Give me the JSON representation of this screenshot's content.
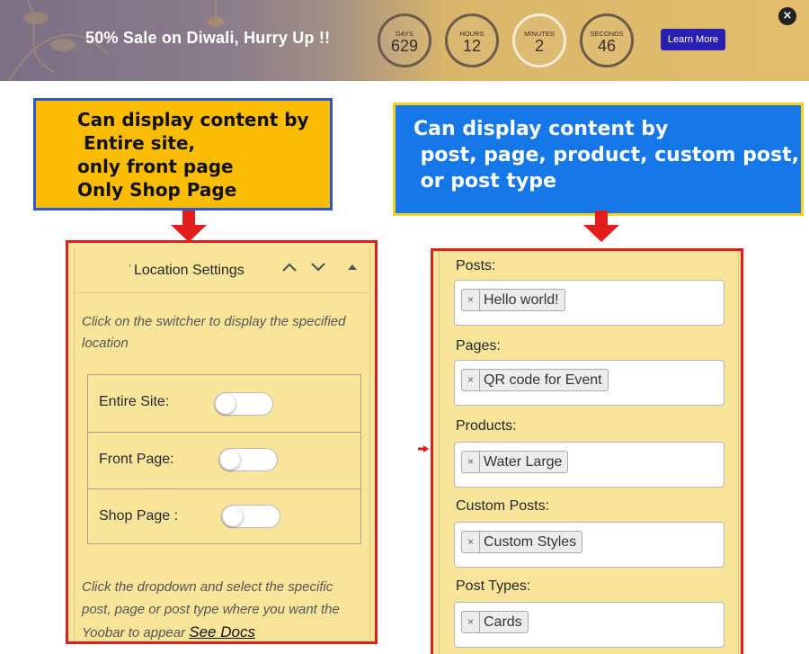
{
  "promo": {
    "text": "50% Sale on Diwali, Hurry Up !!",
    "timers": [
      {
        "unit": "DAYS",
        "value": "629"
      },
      {
        "unit": "HOURS",
        "value": "12"
      },
      {
        "unit": "MINUTES",
        "value": "2"
      },
      {
        "unit": "SECONDS",
        "value": "46"
      }
    ],
    "button_label": "Learn More",
    "close_icon": "×",
    "button_color": "#2a1fb3"
  },
  "callouts": {
    "left_lines": [
      "Can display content by",
      " Entire site,",
      "only front page",
      "Only Shop Page"
    ],
    "right_lines": [
      "Can display content by",
      " post, page, product, custom post,",
      " or post type"
    ],
    "left_bg": "#fbbc04",
    "right_bg": "#1677e8"
  },
  "location_panel": {
    "tick": "'",
    "title": "Location Settings",
    "icons": [
      "chevron-up-icon",
      "chevron-down-icon",
      "triangle-up-icon"
    ],
    "description": "Click on the switcher to display the specified location",
    "switches": [
      {
        "label": "Entire Site:",
        "on": false
      },
      {
        "label": "Front Page:",
        "on": false
      },
      {
        "label": "Shop Page :",
        "on": false
      }
    ],
    "footer_text": "Click the dropdown and select the specific post, page or post type where you want the Yoobar to appear ",
    "docs_link": "See Docs"
  },
  "selectors_panel": {
    "fields": [
      {
        "label": "Posts:",
        "chips": [
          "Hello world!"
        ]
      },
      {
        "label": "Pages:",
        "chips": [
          "QR code for Event"
        ]
      },
      {
        "label": "Products:",
        "chips": [
          "Water Large"
        ]
      },
      {
        "label": "Custom Posts:",
        "chips": [
          "Custom Styles"
        ]
      },
      {
        "label": "Post Types:",
        "chips": [
          "Cards"
        ]
      }
    ],
    "chip_remove": "×"
  },
  "accent_red": "#e11d1d"
}
